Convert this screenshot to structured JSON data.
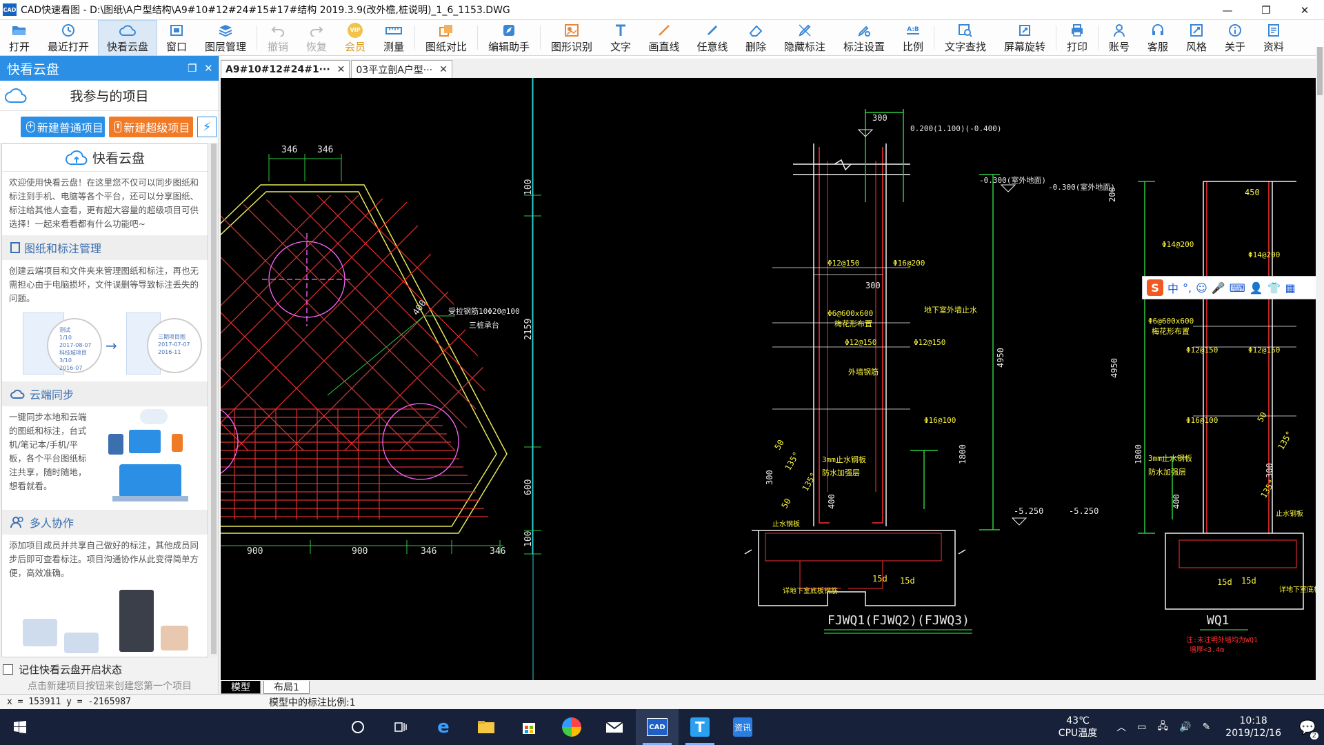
{
  "window": {
    "title": "CAD快速看图 - D:\\图纸\\A户型结构\\A9#10#12#24#15#17#结构 2019.3.9(改外檐,桩说明)_1_6_1153.DWG",
    "logo_text": "CAD"
  },
  "toolbar": {
    "items": [
      {
        "label": "打开",
        "icon": "folder-open-icon"
      },
      {
        "label": "最近打开",
        "icon": "clock-icon"
      },
      {
        "label": "快看云盘",
        "icon": "cloud-icon"
      },
      {
        "label": "窗口",
        "icon": "window-icon"
      },
      {
        "label": "图层管理",
        "icon": "layers-icon"
      },
      {
        "label": "撤销",
        "icon": "undo-icon"
      },
      {
        "label": "恢复",
        "icon": "redo-icon"
      },
      {
        "label": "会员",
        "icon": "vip-icon"
      },
      {
        "label": "测量",
        "icon": "ruler-icon"
      },
      {
        "label": "图纸对比",
        "icon": "compare-icon"
      },
      {
        "label": "编辑助手",
        "icon": "edit-assistant-icon"
      },
      {
        "label": "图形识别",
        "icon": "shape-recognize-icon"
      },
      {
        "label": "文字",
        "icon": "text-icon"
      },
      {
        "label": "画直线",
        "icon": "line-icon"
      },
      {
        "label": "任意线",
        "icon": "pen-icon"
      },
      {
        "label": "删除",
        "icon": "eraser-icon"
      },
      {
        "label": "隐藏标注",
        "icon": "hide-mark-icon"
      },
      {
        "label": "标注设置",
        "icon": "mark-settings-icon"
      },
      {
        "label": "比例",
        "icon": "scale-icon"
      },
      {
        "label": "文字查找",
        "icon": "text-search-icon"
      },
      {
        "label": "屏幕旋转",
        "icon": "rotate-icon"
      },
      {
        "label": "打印",
        "icon": "printer-icon"
      },
      {
        "label": "账号",
        "icon": "user-icon"
      },
      {
        "label": "客服",
        "icon": "headset-icon"
      },
      {
        "label": "风格",
        "icon": "style-icon"
      },
      {
        "label": "关于",
        "icon": "info-icon"
      },
      {
        "label": "资料",
        "icon": "docs-icon"
      }
    ],
    "vip_text": "VIP",
    "scale_text": "A:B"
  },
  "left_panel": {
    "header": "快看云盘",
    "project_title": "我参与的项目",
    "btn_new_normal": "新建普通项目",
    "btn_new_super": "新建超级项目",
    "cloud_title": "快看云盘",
    "intro": "欢迎使用快看云盘！在这里您不仅可以同步图纸和标注到手机、电脑等各个平台，还可以分享图纸、标注给其他人查看，更有超大容量的超级项目可供选择！一起来看看都有什么功能吧~",
    "sections": [
      {
        "title": "图纸和标注管理",
        "text": "创建云端项目和文件夹来管理图纸和标注，再也无需担心由于电脑损坏，文件误删等导致标注丢失的问题。"
      },
      {
        "title": "云端同步",
        "text": "一键同步本地和云端的图纸和标注，台式机/笔记本/手机/平板，各个平台图纸标注共享，随时随地，想看就看。"
      },
      {
        "title": "多人协作",
        "text": "添加项目成员并共享自己做好的标注，其他成员同步后即可查看标注。项目沟通协作从此变得简单方便，高效准确。"
      }
    ],
    "illus_labels": [
      "测试",
      "1/10",
      "2017-08-07",
      "科技城项目",
      "3/10",
      "2016-07",
      "三期项目图",
      "2017-07-07",
      "2016-11"
    ],
    "remember_label": "记住快看云盘开启状态",
    "hint": "点击新建项目按钮来创建您第一个项目"
  },
  "drawing": {
    "tabs": [
      {
        "label": "A9#10#12#24#1···",
        "active": true
      },
      {
        "label": "03平立剖A户型···",
        "active": false
      }
    ],
    "layout_tabs": [
      "模型",
      "布局1"
    ],
    "cad_text": {
      "d346a": "346",
      "d346b": "346",
      "d100a": "100",
      "d2159": "2159",
      "d600": "600",
      "d100b": "100",
      "d900a": "900",
      "d900b": "900",
      "d346c": "346",
      "d346d": "346",
      "d400": "400",
      "note1": "受拉钢筋10Φ20@100",
      "note2": "三桩承台",
      "d300a": "300",
      "elev1": "0.200(1.100)(-0.400)",
      "elev2": "-0.300(室外地面)",
      "elev3": "-0.300(室外地面)",
      "r1": "Φ12@150",
      "r2": "Φ16@200",
      "d300b": "300",
      "r3": "Φ6@600x600",
      "r4": "梅花形布置",
      "r5": "Φ12@150",
      "r6": "Φ12@150",
      "r7": "地下室外墙止水",
      "r8": "外墙钢筋",
      "r9": "Φ16@100",
      "d4950a": "4950",
      "d1800a": "1800",
      "n1": "3mm止水钢板",
      "n2": "防水加强层",
      "d400b": "400",
      "e525a": "-5.250",
      "e525b": "-5.250",
      "d15a": "15d",
      "d15b": "15d",
      "n3": "详地下室底板钢筋",
      "label1": "FJWQ1(FJWQ2)(FJWQ3)",
      "d200": "200",
      "d450": "450",
      "r10": "Φ14@200",
      "r11": "Φ14@200",
      "r12": "Φ6@600x600",
      "r13": "梅花形布置",
      "r14": "Φ12@150",
      "r15": "Φ12@150",
      "r16": "Φ16@100",
      "d4950b": "4950",
      "d1800b": "1800",
      "n4": "3mm止水钢板",
      "n5": "防水加强层",
      "d400c": "400",
      "d15c": "15d",
      "d15d": "15d",
      "label2": "WQ1",
      "n6": "注:未注明外墙均为WQ1",
      "n7": "墙厚<3.4m",
      "d50": "50",
      "d135": "135°",
      "d300c": "300",
      "d135b": "135°",
      "d50b": "50",
      "n8": "止水钢板",
      "n9": "止水钢板",
      "d50c": "50",
      "d135c": "135°",
      "d300d": "300",
      "d135d": "135°",
      "n10": "详地下室底板钢筋"
    }
  },
  "ime": {
    "logo": "S",
    "label": "中",
    "punct": "°,"
  },
  "status": {
    "coords": "x = 153911 y = -2165987",
    "scale": "模型中的标注比例:1"
  },
  "taskbar": {
    "apps": [
      {
        "name": "cortana-icon"
      },
      {
        "name": "task-view-icon"
      },
      {
        "name": "edge-icon"
      },
      {
        "name": "file-explorer-icon"
      },
      {
        "name": "store-icon"
      },
      {
        "name": "browser-360-icon"
      },
      {
        "name": "mail-icon"
      },
      {
        "name": "cad-viewer-icon"
      },
      {
        "name": "text-app-icon"
      },
      {
        "name": "news-app-icon"
      }
    ],
    "cad_text": "CAD",
    "t_text": "T",
    "news_text": "资讯",
    "temp": "43℃",
    "temp_label": "CPU温度",
    "time": "10:18",
    "date": "2019/12/16",
    "notif_count": "2"
  }
}
